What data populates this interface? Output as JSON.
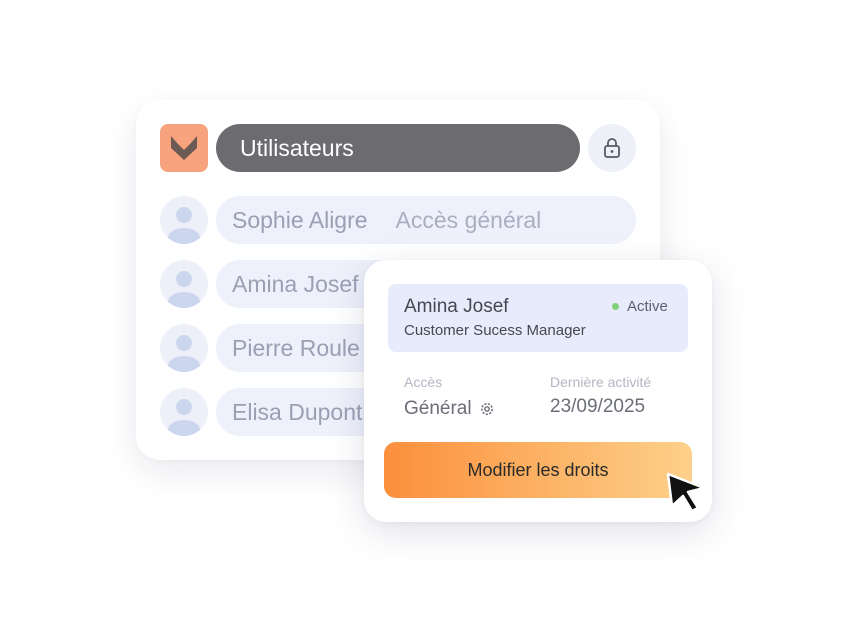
{
  "header": {
    "title": "Utilisateurs",
    "logo_icon": "fox-logo",
    "lock_icon": "lock-icon",
    "brand_color": "#f7a47e"
  },
  "users": [
    {
      "name": "Sophie Aligre",
      "access": "Accès général"
    },
    {
      "name": "Amina Josef",
      "access": ""
    },
    {
      "name": "Pierre Roule",
      "access": ""
    },
    {
      "name": "Elisa Dupont",
      "access": ""
    }
  ],
  "detail": {
    "name": "Amina Josef",
    "role": "Customer Sucess Manager",
    "status": "Active",
    "status_color": "#7fd27a",
    "access_label": "Accès",
    "access_value": "Général",
    "last_activity_label": "Dernière activité",
    "last_activity_value": "23/09/2025",
    "button_label": "Modifier les droits"
  }
}
